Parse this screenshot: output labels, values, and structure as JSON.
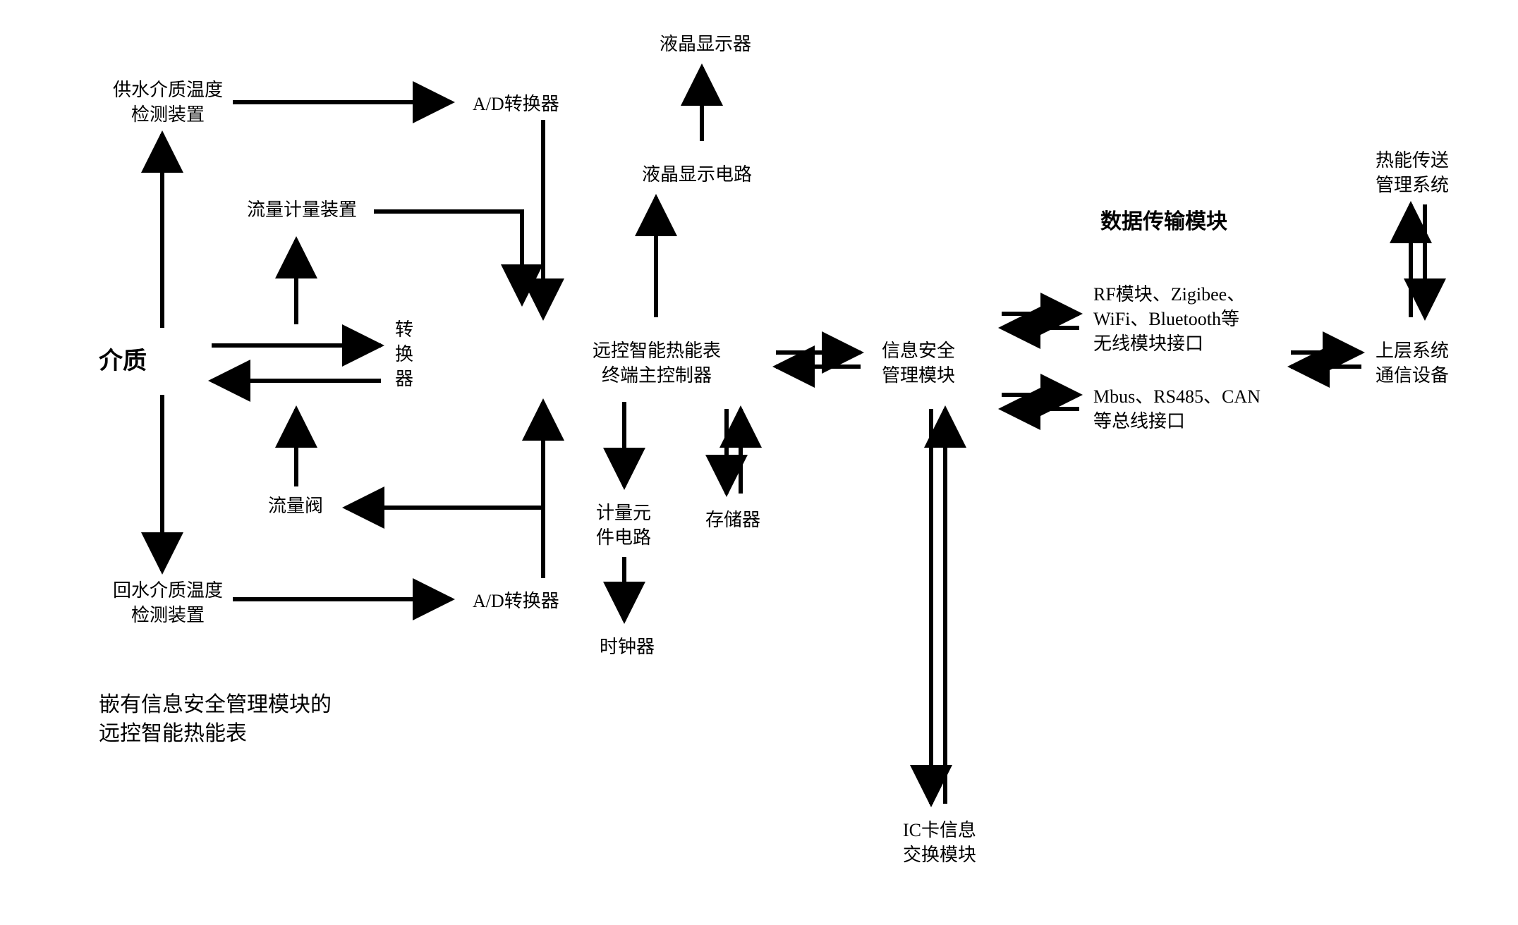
{
  "nodes": {
    "medium": "介质",
    "supply_temp": "供水介质温度\n检测装置",
    "return_temp": "回水介质温度\n检测装置",
    "flow_meter": "流量计量装置",
    "flow_valve": "流量阀",
    "rotor": "转\n换\n器",
    "adc_top": "A/D转换器",
    "adc_bottom": "A/D转换器",
    "controller": "远控智能热能表\n终端主控制器",
    "lcd_display": "液晶显示器",
    "lcd_circuit": "液晶显示电路",
    "metering_ic": "计量元\n件电路",
    "clock": "时钟器",
    "storage": "存储器",
    "ic_card": "IC卡信息\n交换模块",
    "security": "信息安全\n管理模块",
    "data_title": "数据传输模块",
    "wireless": "RF模块、Zigibee、\nWiFi、Bluetooth等\n无线模块接口",
    "wired": "Mbus、RS485、CAN\n等总线接口",
    "upper_comm": "上层系统\n通信设备",
    "mgmt_sys": "热能传送\n管理系统",
    "caption": "嵌有信息安全管理模块的\n远控智能热能表"
  }
}
